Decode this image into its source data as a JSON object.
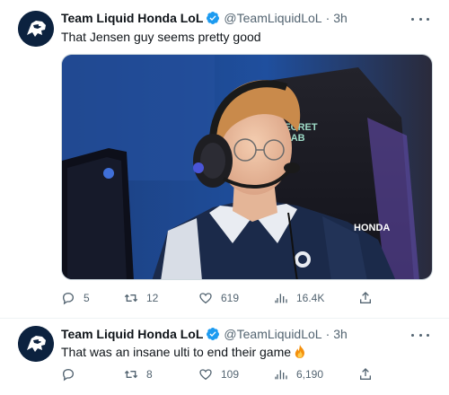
{
  "tweets": [
    {
      "author_name": "Team Liquid Honda LoL",
      "handle": "@TeamLiquidLoL",
      "separator": "·",
      "time": "3h",
      "text": "That Jensen guy seems pretty good",
      "media": {
        "overlay_text_1": "SECRET",
        "overlay_text_2": "LAB",
        "jersey_text": "HONDA"
      },
      "replies": "5",
      "retweets": "12",
      "likes": "619",
      "views": "16.4K"
    },
    {
      "author_name": "Team Liquid Honda LoL",
      "handle": "@TeamLiquidLoL",
      "separator": "·",
      "time": "3h",
      "text": "That was an insane ulti to end their game",
      "emoji": "fire",
      "replies": "",
      "retweets": "8",
      "likes": "109",
      "views": "6,190"
    }
  ],
  "colors": {
    "verified": "#1d9bf0",
    "text": "#0f1419",
    "muted": "#536471",
    "avatar_bg": "#0c223f"
  },
  "icons": [
    "verified-badge-icon",
    "more-icon",
    "reply-icon",
    "retweet-icon",
    "like-icon",
    "views-icon",
    "share-icon",
    "fire-emoji-icon",
    "team-liquid-horse-logo"
  ]
}
